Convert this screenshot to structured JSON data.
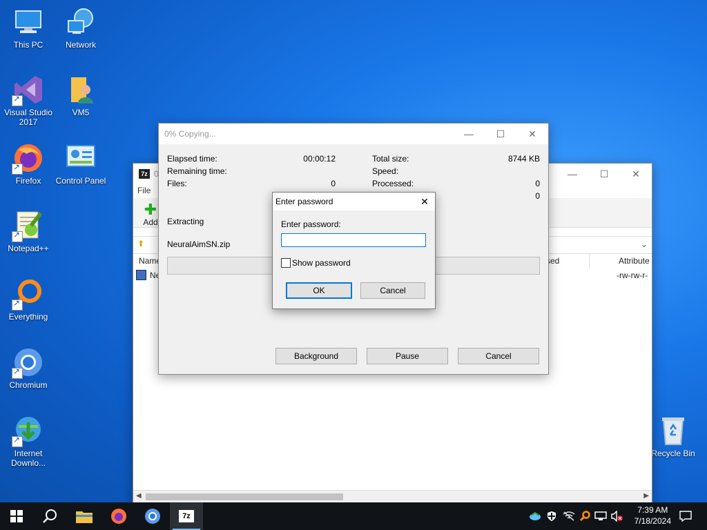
{
  "desktop": {
    "icons": [
      {
        "label": "This PC"
      },
      {
        "label": "Network"
      },
      {
        "label": "Visual Studio 2017"
      },
      {
        "label": "VM5"
      },
      {
        "label": "Firefox"
      },
      {
        "label": "Control Panel"
      },
      {
        "label": "Notepad++"
      },
      {
        "label": "Everything"
      },
      {
        "label": "Chromium"
      },
      {
        "label": "Internet Downlo..."
      },
      {
        "label": "Recycle Bin"
      }
    ]
  },
  "file_manager": {
    "title_fragment": "0",
    "menu_file": "File",
    "toolbar_add": "Add",
    "columns": {
      "name": "Name",
      "packed": "sed",
      "attributes": "Attribute"
    },
    "row": {
      "name": "Ne",
      "attributes": "-rw-rw-r-"
    }
  },
  "copy_window": {
    "title": "0% Copying...",
    "elapsed_label": "Elapsed time:",
    "elapsed_value": "00:00:12",
    "remaining_label": "Remaining time:",
    "files_label": "Files:",
    "files_value": "0",
    "total_size_label": "Total size:",
    "total_size_value": "8744 KB",
    "speed_label": "Speed:",
    "processed_label": "Processed:",
    "processed_value": "0",
    "extra_value": "0",
    "operation": "Extracting",
    "filename": "NeuralAimSN.zip",
    "progress": 0,
    "buttons": {
      "background": "Background",
      "pause": "Pause",
      "cancel": "Cancel"
    }
  },
  "password_dialog": {
    "title": "Enter password",
    "prompt": "Enter password:",
    "value": "",
    "show_password_label": "Show password",
    "show_password_checked": false,
    "ok": "OK",
    "cancel": "Cancel"
  },
  "taskbar": {
    "apps": [
      "start-icon",
      "search-icon",
      "file-explorer-icon",
      "firefox-icon",
      "chromium-icon",
      "7zip-icon"
    ],
    "time": "7:39 AM",
    "date": "7/18/2024"
  },
  "colors": {
    "accent": "#0078d7",
    "desktop": "#1a78e8",
    "taskbar": "#101418"
  }
}
